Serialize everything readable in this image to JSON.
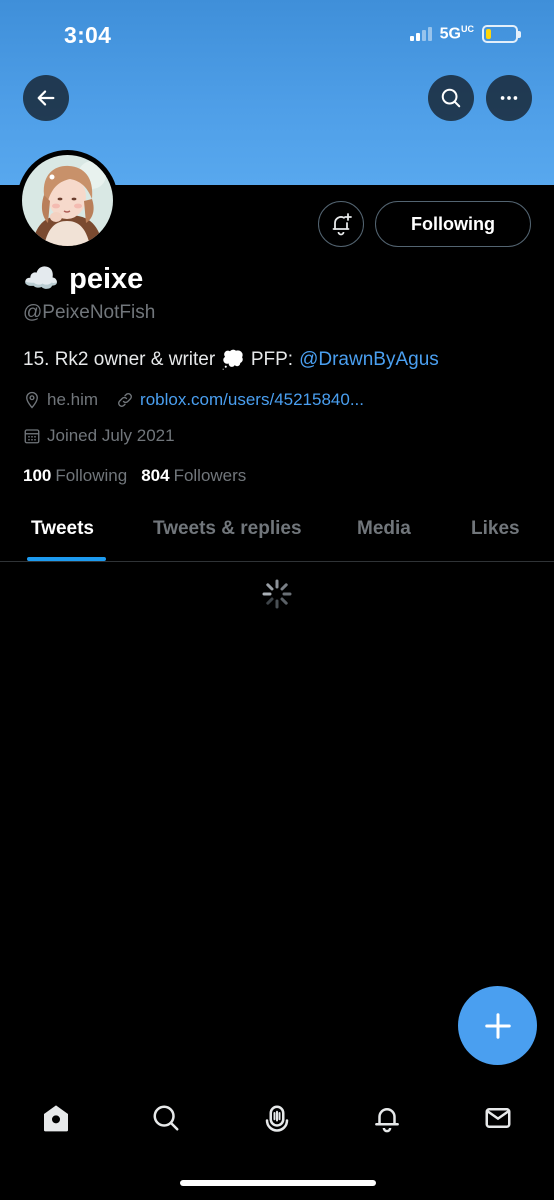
{
  "status_bar": {
    "time": "3:04",
    "network": "5G",
    "network_sup": "UC"
  },
  "header": {
    "back_icon": "arrow-left-icon",
    "search_icon": "search-icon",
    "more_icon": "more-horizontal-icon",
    "banner_color": "#4f9fe8"
  },
  "profile": {
    "name_emoji": "☁️",
    "name": "peixe",
    "handle": "@PeixeNotFish",
    "bio_text": "15. Rk2 owner & writer",
    "bio_emoji": "💭",
    "bio_pfp_label": "PFP:",
    "bio_mention": "@DrawnByAgus",
    "location": "he.him",
    "website": "roblox.com/users/45215840...",
    "joined": "Joined July 2021",
    "following_count": "100",
    "following_label": "Following",
    "followers_count": "804",
    "followers_label": "Followers"
  },
  "actions": {
    "notify_icon": "bell-plus-icon",
    "following_button": "Following"
  },
  "tabs": [
    {
      "label": "Tweets",
      "active": true
    },
    {
      "label": "Tweets & replies",
      "active": false
    },
    {
      "label": "Media",
      "active": false
    },
    {
      "label": "Likes",
      "active": false
    }
  ],
  "fab": {
    "icon": "plus-icon"
  },
  "bottom_nav": [
    "home-icon",
    "search-icon",
    "spaces-icon",
    "notifications-icon",
    "messages-icon"
  ],
  "colors": {
    "accent": "#1d9bf0",
    "link": "#4a9ff0",
    "muted": "#71767b"
  }
}
